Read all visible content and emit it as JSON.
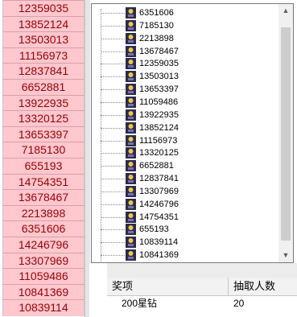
{
  "sheet": {
    "cells": [
      "12359035",
      "13852124",
      "13503013",
      "11156973",
      "12837841",
      "6652881",
      "13922935",
      "13320125",
      "13653397",
      "7185130",
      "655193",
      "14754351",
      "13678467",
      "2213898",
      "6351606",
      "14246796",
      "13307969",
      "11059486",
      "10841369",
      "10839114"
    ]
  },
  "tree": {
    "items": [
      "6351606",
      "7185130",
      "2213898",
      "13678467",
      "12359035",
      "13503013",
      "13653397",
      "11059486",
      "13922935",
      "13852124",
      "11156973",
      "13320125",
      "6652881",
      "12837841",
      "13307969",
      "14246796",
      "14754351",
      "655193",
      "10839114",
      "10841369"
    ]
  },
  "scrollbar": {
    "up": "▲",
    "down": "▼"
  },
  "table": {
    "headers": [
      "奖项",
      "抽取人数"
    ],
    "rows": [
      [
        "200星钻",
        "20"
      ]
    ]
  },
  "colors": {
    "cell_bg": "#ffc7ce",
    "cell_text": "#9c0006",
    "flag": "#2f8a3a"
  }
}
